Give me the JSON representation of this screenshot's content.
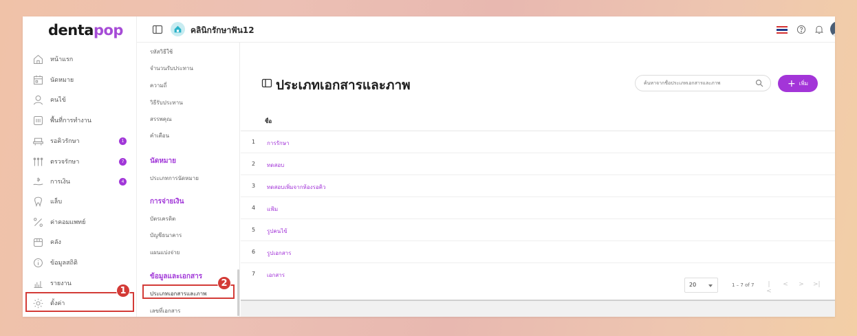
{
  "brand": {
    "logo_main": "denta",
    "logo_accent": "pop",
    "accent_color": "#a335d8"
  },
  "header": {
    "clinic_name": "คลินิกรักษาฟัน12"
  },
  "sidebar": {
    "items": [
      {
        "label": "หน้าแรก"
      },
      {
        "label": "นัดหมาย"
      },
      {
        "label": "คนไข้"
      },
      {
        "label": "พื้นที่การทำงาน"
      },
      {
        "label": "รอคิวรักษา",
        "badge": "1"
      },
      {
        "label": "ตรวจรักษา",
        "badge": "7"
      },
      {
        "label": "การเงิน",
        "badge": "4"
      },
      {
        "label": "แล็บ"
      },
      {
        "label": "ค่าคอมแพทย์"
      },
      {
        "label": "คลัง"
      },
      {
        "label": "ข้อมูลสถิติ"
      },
      {
        "label": "รายงาน"
      },
      {
        "label": "ตั้งค่า"
      }
    ]
  },
  "submenu": {
    "top_items": [
      "รหัสวิธีใช้",
      "จำนวนรับประทาน",
      "ความถี่",
      "วิธีรับประทาน",
      "สรรพคุณ",
      "คำเตือน"
    ],
    "sections": [
      {
        "heading": "นัดหมาย",
        "items": [
          "ประเภทการนัดหมาย"
        ]
      },
      {
        "heading": "การจ่ายเงิน",
        "items": [
          "บัตรเครดิต",
          "บัญชีธนาคาร",
          "แผนแบ่งจ่าย"
        ]
      },
      {
        "heading": "ข้อมูลและเอกสาร",
        "items": [
          "ประเภทเอกสารและภาพ",
          "เลขที่เอกสาร"
        ]
      }
    ]
  },
  "callouts": [
    "1",
    "2"
  ],
  "main": {
    "title": "ประเภทเอกสารและภาพ",
    "search_placeholder": "ค้นหาจากชื่อประเภทเอกสารและภาพ",
    "add_label": "เพิ่ม",
    "column_name": "ชื่อ",
    "rows": [
      {
        "num": "1",
        "name": "การรักษา"
      },
      {
        "num": "2",
        "name": "ทดสอบ"
      },
      {
        "num": "3",
        "name": "ทดสอบเพิ่มจากห้องรอคิว"
      },
      {
        "num": "4",
        "name": "แฟ้ม"
      },
      {
        "num": "5",
        "name": "รูปคนไข้"
      },
      {
        "num": "6",
        "name": "รูปเอกสาร"
      },
      {
        "num": "7",
        "name": "เอกสาร"
      }
    ],
    "pagination": {
      "page_size": "20",
      "range": "1 – 7 of 7"
    }
  }
}
